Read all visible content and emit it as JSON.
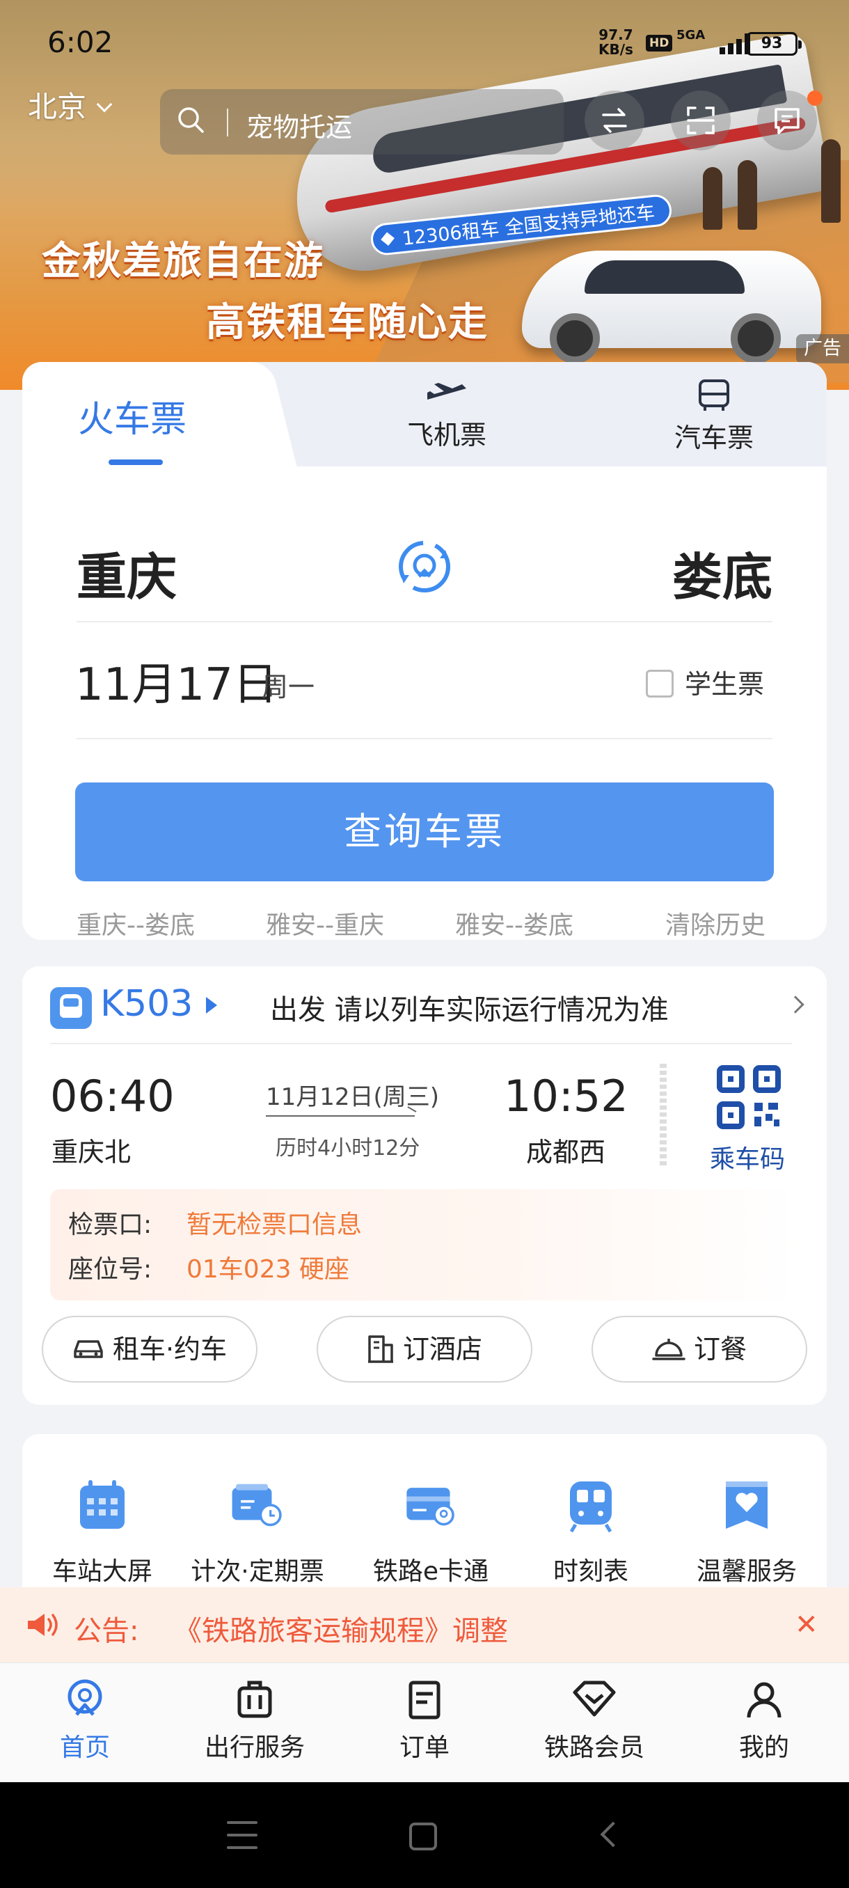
{
  "status": {
    "time": "6:02",
    "speed_value": "97.7",
    "speed_unit": "KB/s",
    "hd": "HD",
    "network": "5GA",
    "battery": "93"
  },
  "header": {
    "city": "北京",
    "search_placeholder": "宠物托运"
  },
  "banner": {
    "slogan_line1": "金秋差旅自在游",
    "slogan_line2": "高铁租车随心走",
    "pill": "12306租车 全国支持异地还车",
    "ad_tag": "广告"
  },
  "ticket": {
    "tabs": [
      {
        "label": "火车票",
        "active": true
      },
      {
        "label": "飞机票",
        "active": false
      },
      {
        "label": "汽车票",
        "active": false
      }
    ],
    "from": "重庆",
    "to": "娄底",
    "date": "11月17日",
    "weekday": "周一",
    "student_label": "学生票",
    "query_button": "查询车票",
    "history": [
      "重庆--娄底",
      "雅安--重庆",
      "雅安--娄底"
    ],
    "clear_history": "清除历史"
  },
  "trip": {
    "train_no": "K503",
    "notice": "出发 请以列车实际运行情况为准",
    "depart_time": "06:40",
    "depart_station": "重庆北",
    "arrive_time": "10:52",
    "arrive_station": "成都西",
    "date": "11月12日(周三)",
    "duration": "历时4小时12分",
    "qr_label": "乘车码",
    "gate_label": "检票口:",
    "gate_value": "暂无检票口信息",
    "seat_label": "座位号:",
    "seat_value": "01车023 硬座",
    "buttons": [
      "租车·约车",
      "订酒店",
      "订餐"
    ]
  },
  "quick_services": [
    "车站大屏",
    "计次·定期票",
    "铁路e卡通",
    "时刻表",
    "温馨服务"
  ],
  "notice": {
    "label": "公告:",
    "text": "《铁路旅客运输规程》调整"
  },
  "bottom_nav": [
    {
      "label": "首页",
      "icon": "home-icon",
      "active": true
    },
    {
      "label": "出行服务",
      "icon": "luggage-icon",
      "active": false
    },
    {
      "label": "订单",
      "icon": "order-icon",
      "active": false
    },
    {
      "label": "铁路会员",
      "icon": "diamond-icon",
      "active": false
    },
    {
      "label": "我的",
      "icon": "profile-icon",
      "active": false
    }
  ],
  "colors": {
    "accent": "#3579e6",
    "button": "#5495f0",
    "warning": "#ef7a3a",
    "notice": "#ef5a3c",
    "banner": "#f08a2a"
  }
}
